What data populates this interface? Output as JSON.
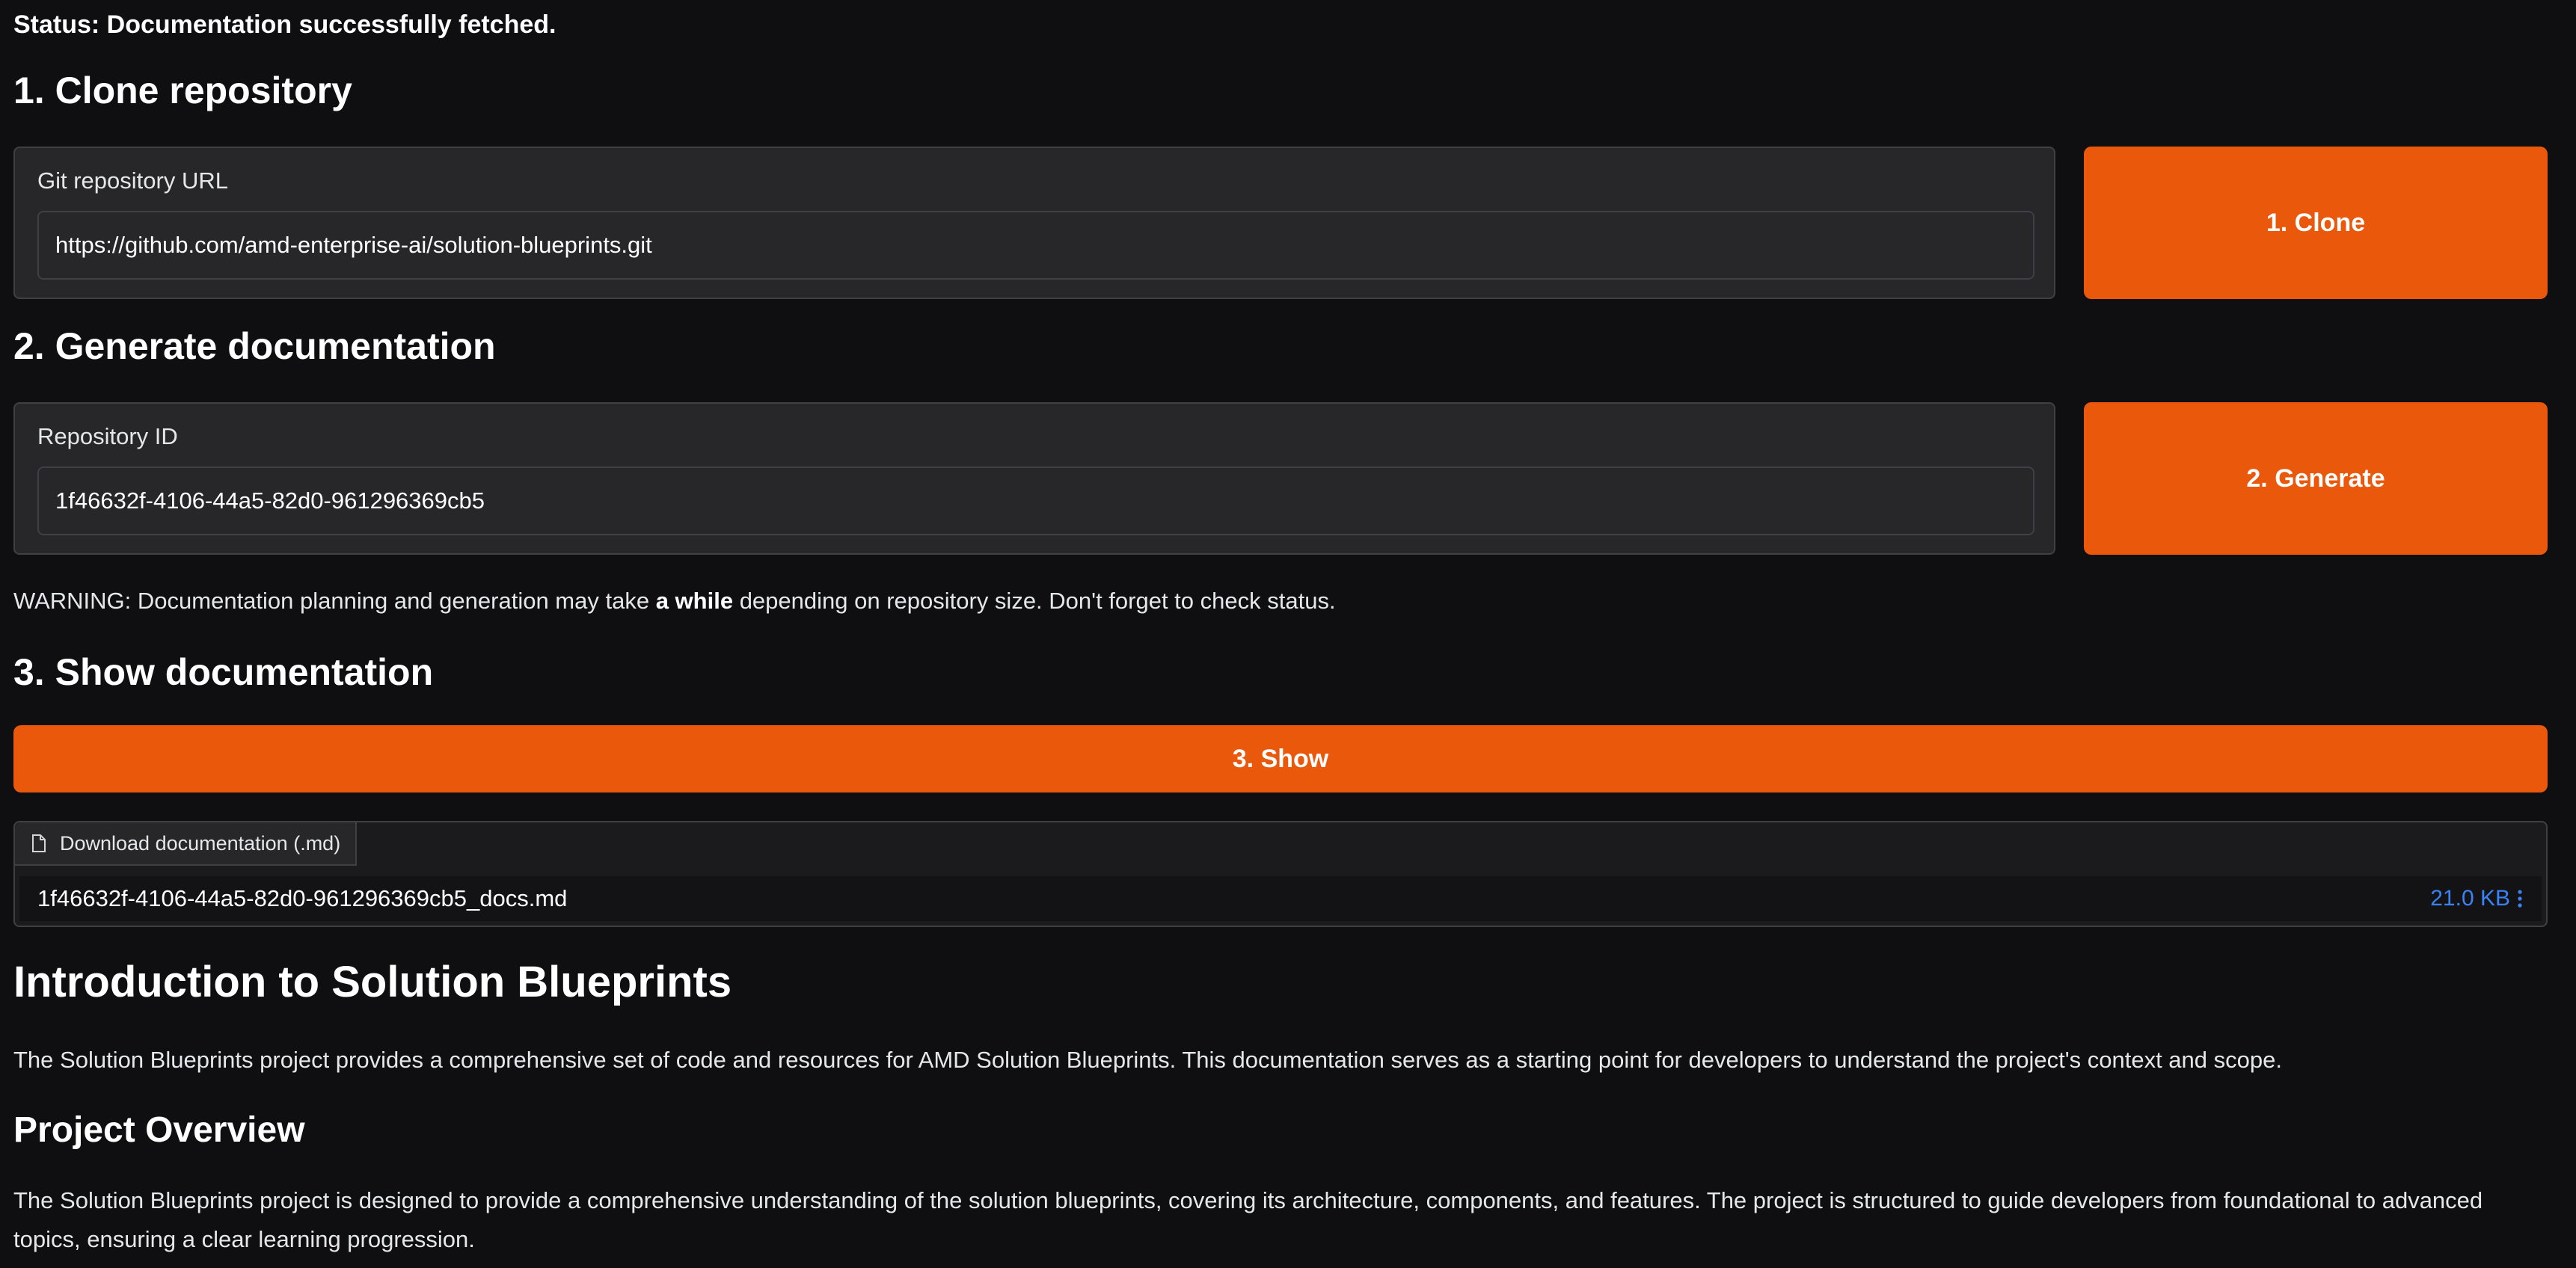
{
  "status": "Status: Documentation successfully fetched.",
  "section1": {
    "heading": "1. Clone repository",
    "field_label": "Git repository URL",
    "field_value": "https://github.com/amd-enterprise-ai/solution-blueprints.git",
    "button_label": "1. Clone"
  },
  "section2": {
    "heading": "2. Generate documentation",
    "field_label": "Repository ID",
    "field_value": "1f46632f-4106-44a5-82d0-961296369cb5",
    "button_label": "2. Generate"
  },
  "warning": {
    "prefix": "WARNING: Documentation planning and generation may take ",
    "emphasis": "a while",
    "suffix": " depending on repository size. Don't forget to check status."
  },
  "section3": {
    "heading": "3. Show documentation",
    "button_label": "3. Show"
  },
  "download": {
    "tab_label": "Download documentation (.md)",
    "tab_icon": "file-icon",
    "file_name": "1f46632f-4106-44a5-82d0-961296369cb5_docs.md",
    "file_size": "21.0 KB",
    "menu_icon": "kebab-menu-icon"
  },
  "doc": {
    "title": "Introduction to Solution Blueprints",
    "intro": "The Solution Blueprints project provides a comprehensive set of code and resources for AMD Solution Blueprints. This documentation serves as a starting point for developers to understand the project's context and scope.",
    "overview_heading": "Project Overview",
    "overview_text": "The Solution Blueprints project is designed to provide a comprehensive understanding of the solution blueprints, covering its architecture, components, and features. The project is structured to guide developers from foundational to advanced topics, ensuring a clear learning progression."
  },
  "colors": {
    "accent": "#ea580c",
    "background": "#0f0f11",
    "panel": "#27272a",
    "link": "#3b82f6"
  }
}
